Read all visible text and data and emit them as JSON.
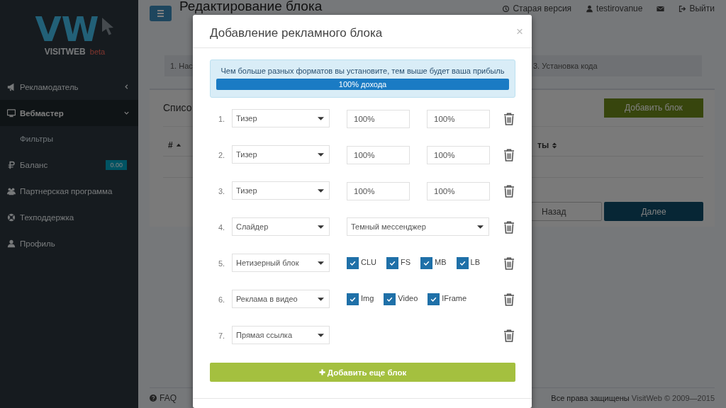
{
  "sidebar": {
    "logo": {
      "mark": "VW",
      "name": "VISITWEB",
      "tag": "beta"
    },
    "items": [
      {
        "label": "Рекламодатель",
        "selected": false,
        "expanded": false
      },
      {
        "label": "Вебмастер",
        "selected": true,
        "expanded": true,
        "children": [
          {
            "label": "Фильтры",
            "selected": false
          }
        ]
      },
      {
        "label": "Баланс",
        "selected": false,
        "badge": "0.00"
      },
      {
        "label": "Партнерская программа",
        "selected": false
      },
      {
        "label": "Техподдержка",
        "selected": false
      },
      {
        "label": "Профиль",
        "selected": false
      }
    ]
  },
  "header": {
    "title": "Редактирование блока",
    "links": [
      {
        "kind": "text",
        "label": "Старая версия"
      },
      {
        "kind": "text",
        "label": "testirovanue"
      },
      {
        "kind": "icon"
      },
      {
        "kind": "text",
        "label": "Выйти"
      }
    ]
  },
  "steps": [
    "1. Нас",
    "3. Установка кода"
  ],
  "panel": {
    "title": "Списо",
    "add_button": "Добавить блок",
    "columns": [
      {
        "label": "#",
        "sorted": true
      },
      {
        "label": "ты",
        "sorted": false
      }
    ],
    "buttons": [
      {
        "label": "Назад",
        "kind": "default"
      },
      {
        "label": "Далее",
        "kind": "primary"
      }
    ]
  },
  "footer": {
    "faq": "FAQ",
    "copyright": "**Все права защищены** VisitWeb © 2009—2015"
  },
  "modal": {
    "title": "Добавление рекламного блока",
    "close": "×",
    "hint": "Чем больше разных форматов вы установите, тем выше будет ваша прибыль",
    "progress": {
      "level": 1,
      "label": "100% дохода"
    },
    "rows": [
      {
        "number": "1.",
        "type": "Тизер",
        "kind": "sizes",
        "values": [
          "100%",
          "100%"
        ]
      },
      {
        "number": "2.",
        "type": "Тизер",
        "kind": "sizes",
        "values": [
          "100%",
          "100%"
        ]
      },
      {
        "number": "3.",
        "type": "Тизер",
        "kind": "sizes",
        "values": [
          "100%",
          "100%"
        ]
      },
      {
        "number": "4.",
        "type": "Слайдер",
        "kind": "select",
        "option": "Темный мессенджер"
      },
      {
        "number": "5.",
        "type": "Нетизерный блок",
        "kind": "checks",
        "checks": [
          {
            "label": "CLU",
            "checked": true
          },
          {
            "label": "FS",
            "checked": true
          },
          {
            "label": "MB",
            "checked": true
          },
          {
            "label": "LB",
            "checked": true
          }
        ]
      },
      {
        "number": "6.",
        "type": "Реклама в видео",
        "kind": "checks",
        "checks": [
          {
            "label": "Img",
            "checked": true
          },
          {
            "label": "Video",
            "checked": true
          },
          {
            "label": "IFrame",
            "checked": true
          }
        ]
      },
      {
        "number": "7.",
        "type": "Прямая ссылка",
        "kind": "none"
      }
    ],
    "add_button": "Добавить еще блок"
  }
}
